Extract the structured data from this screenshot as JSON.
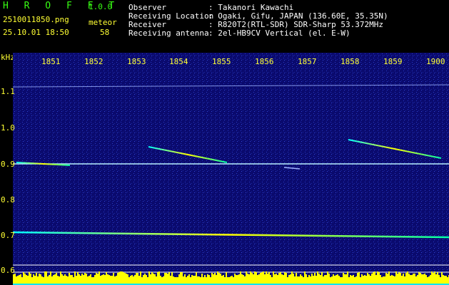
{
  "header": {
    "app_title": "H R O F F T",
    "version": "1.0.0",
    "filename": "2510011850.png",
    "timestamp": "25.10.01 18:50",
    "meteor_label": "meteor",
    "meteor_count": "58",
    "fields": [
      {
        "label": "Observer",
        "value": ": Takanori Kawachi"
      },
      {
        "label": "Receiving Location",
        "value": ": Ogaki, Gifu, JAPAN (136.60E, 35.35N)"
      },
      {
        "label": "Receiver",
        "value": ": R820T2(RTL-SDR) SDR-Sharp 53.372MHz"
      },
      {
        "label": "Receiving antenna",
        "value": ": 2el-HB9CV Vertical (el. E-W)"
      }
    ]
  },
  "axes": {
    "y_unit": "kHz",
    "x_ticks": [
      "1851",
      "1852",
      "1853",
      "1854",
      "1855",
      "1856",
      "1857",
      "1858",
      "1859",
      "1900"
    ],
    "y_ticks": [
      "1.1",
      "1.0",
      "0.9",
      "0.8",
      "0.7",
      "0.6"
    ]
  },
  "colors": {
    "background": "#0a0a6e",
    "title_green": "#39ff14",
    "tick_yellow": "#ffff33",
    "level_yellow": "#ffff00",
    "level_cyan": "#00e5ff"
  }
}
